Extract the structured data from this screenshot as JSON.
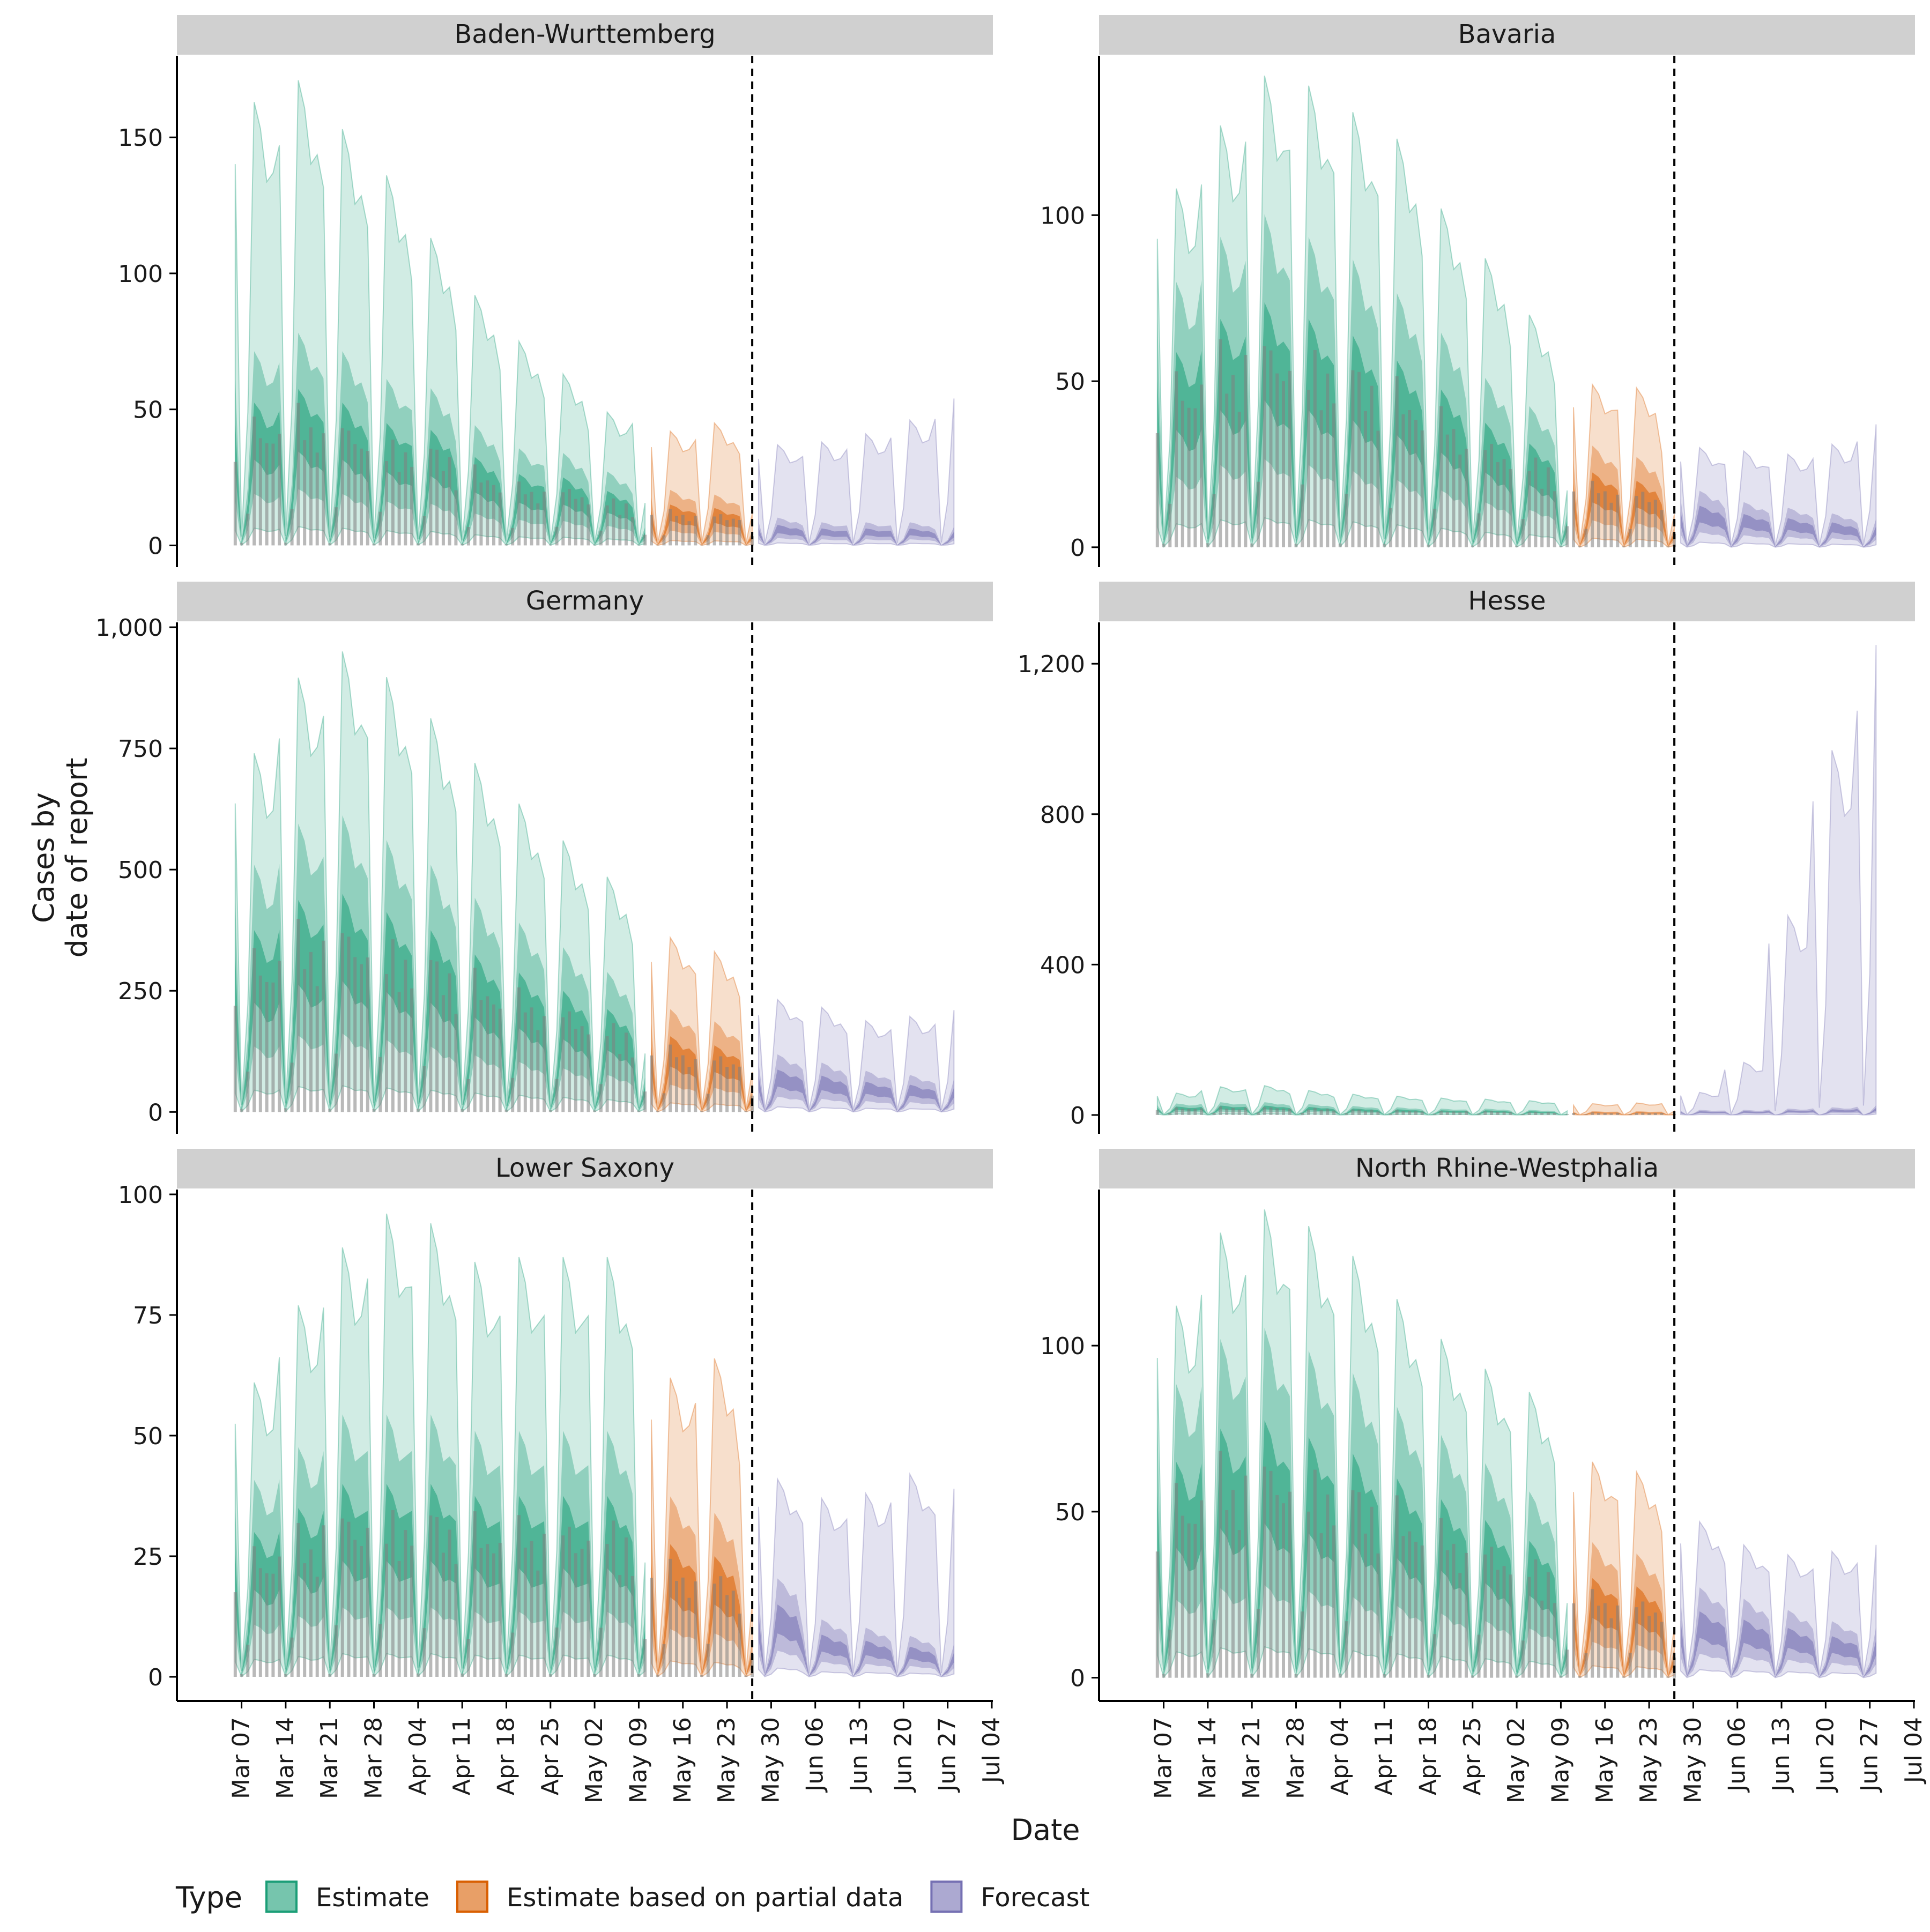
{
  "chart_data": {
    "type": "area",
    "xlabel": "Date",
    "ylabel": "Cases by\ndate of report",
    "x_ticks": [
      "Mar 07",
      "Mar 14",
      "Mar 21",
      "Mar 28",
      "Apr 04",
      "Apr 11",
      "Apr 18",
      "Apr 25",
      "May 02",
      "May 09",
      "May 16",
      "May 23",
      "May 30",
      "Jun 06",
      "Jun 13",
      "Jun 20",
      "Jun 27",
      "Jul 04"
    ],
    "x_range": [
      "2020-03-01",
      "2020-07-04"
    ],
    "x_tick_dates": [
      "2020-03-07",
      "2020-03-14",
      "2020-03-21",
      "2020-03-28",
      "2020-04-04",
      "2020-04-11",
      "2020-04-18",
      "2020-04-25",
      "2020-05-02",
      "2020-05-09",
      "2020-05-16",
      "2020-05-23",
      "2020-05-30",
      "2020-06-06",
      "2020-06-13",
      "2020-06-20",
      "2020-06-27",
      "2020-07-04"
    ],
    "vline_date": "2020-05-27",
    "partial_start": "2020-05-11",
    "forecast_end": "2020-06-28",
    "legend": {
      "title": "Type",
      "position": "bottom",
      "items": [
        {
          "label": "Estimate",
          "color": "#1b9e77"
        },
        {
          "label": "Estimate based on partial data",
          "color": "#d95f02"
        },
        {
          "label": "Forecast",
          "color": "#7570b3"
        }
      ]
    },
    "panels": [
      {
        "title": "Baden-Wurttemberg",
        "ylim": [
          -8,
          180
        ],
        "y_ticks": [
          0,
          50,
          100,
          150
        ],
        "y_tick_labels": [
          "0",
          "50",
          "100",
          "150"
        ],
        "est_peaks": [
          163,
          171,
          153,
          136,
          113,
          92,
          75,
          63,
          49,
          52
        ],
        "est_medians": [
          42,
          46,
          42,
          36,
          34,
          26,
          21,
          20,
          16,
          13
        ],
        "partial_peaks": [
          42,
          45,
          39
        ],
        "partial_medians": [
          12,
          11,
          10
        ],
        "forecast_peaks": [
          37,
          38,
          41,
          46,
          54
        ],
        "forecast_medians": [
          6,
          5,
          5,
          5,
          4
        ]
      },
      {
        "title": "Bavaria",
        "ylim": [
          -6,
          148
        ],
        "y_ticks": [
          0,
          50,
          100
        ],
        "y_tick_labels": [
          "0",
          "50",
          "100"
        ],
        "est_peaks": [
          108,
          127,
          142,
          139,
          131,
          123,
          102,
          87,
          70,
          57
        ],
        "est_medians": [
          47,
          55,
          59,
          55,
          51,
          45,
          38,
          30,
          25,
          21
        ],
        "partial_peaks": [
          49,
          48,
          33
        ],
        "partial_medians": [
          18,
          16,
          12
        ],
        "forecast_peaks": [
          30,
          29,
          28,
          31,
          37
        ],
        "forecast_medians": [
          10,
          8,
          7,
          6,
          5
        ]
      },
      {
        "title": "Germany",
        "ylim": [
          -45,
          1010
        ],
        "y_ticks": [
          0,
          250,
          500,
          750,
          1000
        ],
        "y_tick_labels": [
          "0",
          "250",
          "500",
          "750",
          "1,000"
        ],
        "est_peaks": [
          740,
          896,
          950,
          897,
          812,
          720,
          636,
          560,
          485,
          402
        ],
        "est_medians": [
          300,
          350,
          360,
          330,
          300,
          260,
          230,
          200,
          170,
          140
        ],
        "partial_peaks": [
          360,
          331,
          275
        ],
        "partial_medians": [
          125,
          110,
          100
        ],
        "forecast_peaks": [
          232,
          216,
          188,
          197,
          210
        ],
        "forecast_medians": [
          70,
          60,
          50,
          45,
          40
        ]
      },
      {
        "title": "Hesse",
        "ylim": [
          -50,
          1310
        ],
        "y_ticks": [
          0,
          400,
          800,
          1200
        ],
        "y_tick_labels": [
          "0",
          "400",
          "800",
          "1,200"
        ],
        "est_peaks": [
          58,
          75,
          78,
          65,
          55,
          50,
          45,
          42,
          38,
          36
        ],
        "est_medians": [
          18,
          20,
          20,
          17,
          14,
          12,
          10,
          10,
          8,
          7
        ],
        "partial_peaks": [
          30,
          32,
          35
        ],
        "partial_medians": [
          6,
          6,
          6
        ],
        "forecast_peaks": [
          60,
          140,
          530,
          970,
          1250
        ],
        "forecast_medians": [
          8,
          8,
          10,
          12,
          15
        ]
      },
      {
        "title": "Lower Saxony",
        "ylim": [
          -5,
          101
        ],
        "y_ticks": [
          0,
          25,
          50,
          75,
          100
        ],
        "y_tick_labels": [
          "0",
          "25",
          "50",
          "75",
          "100"
        ],
        "est_peaks": [
          61,
          77,
          89,
          96,
          94,
          86,
          87,
          87,
          87,
          79
        ],
        "est_medians": [
          24,
          28,
          32,
          32,
          32,
          30,
          30,
          30,
          30,
          26
        ],
        "partial_peaks": [
          62,
          66,
          51
        ],
        "partial_medians": [
          22,
          20,
          14
        ],
        "forecast_peaks": [
          41,
          37,
          38,
          42,
          39
        ],
        "forecast_medians": [
          12,
          7,
          6,
          5,
          4
        ]
      },
      {
        "title": "North Rhine-Westphalia",
        "ylim": [
          -7,
          147
        ],
        "y_ticks": [
          0,
          50,
          100
        ],
        "y_tick_labels": [
          "0",
          "50",
          "100"
        ],
        "est_peaks": [
          112,
          134,
          141,
          136,
          127,
          114,
          102,
          93,
          86,
          75
        ],
        "est_medians": [
          52,
          60,
          62,
          58,
          54,
          48,
          43,
          38,
          33,
          28
        ],
        "partial_peaks": [
          65,
          62,
          51
        ],
        "partial_medians": [
          24,
          22,
          18
        ],
        "forecast_peaks": [
          47,
          40,
          37,
          38,
          40
        ],
        "forecast_medians": [
          16,
          14,
          12,
          10,
          9
        ]
      }
    ]
  }
}
